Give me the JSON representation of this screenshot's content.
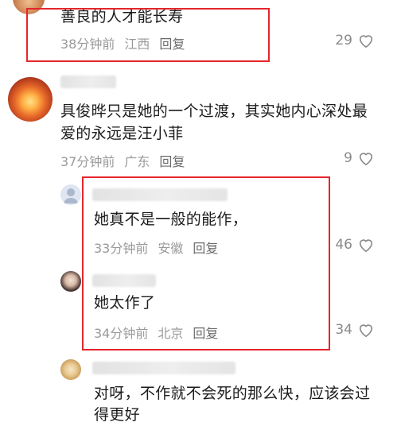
{
  "comments": [
    {
      "text_lines": [
        "善良的人才能长寿"
      ],
      "time": "38分钟前",
      "location": "江西",
      "reply_label": "回复",
      "likes": "29"
    },
    {
      "text_lines": [
        "具俊晔只是她的一个过渡，其实她内心深处最",
        "爱的永远是汪小菲"
      ],
      "time": "37分钟前",
      "location": "广东",
      "reply_label": "回复",
      "likes": "9"
    },
    {
      "text_lines": [
        "她真不是一般的能作，"
      ],
      "time": "33分钟前",
      "location": "安徽",
      "reply_label": "回复",
      "likes": "46"
    },
    {
      "text_lines": [
        "她太作了"
      ],
      "time": "34分钟前",
      "location": "北京",
      "reply_label": "回复",
      "likes": "34"
    },
    {
      "text_lines": [
        "对呀，不作就不会死的那么快，应该会过",
        "得更好"
      ]
    }
  ],
  "colors": {
    "highlight_border": "#e5262c",
    "meta_text": "#9a9a9a",
    "body_text": "#1c1c1c"
  },
  "icons": [
    "heart-outline-icon"
  ]
}
